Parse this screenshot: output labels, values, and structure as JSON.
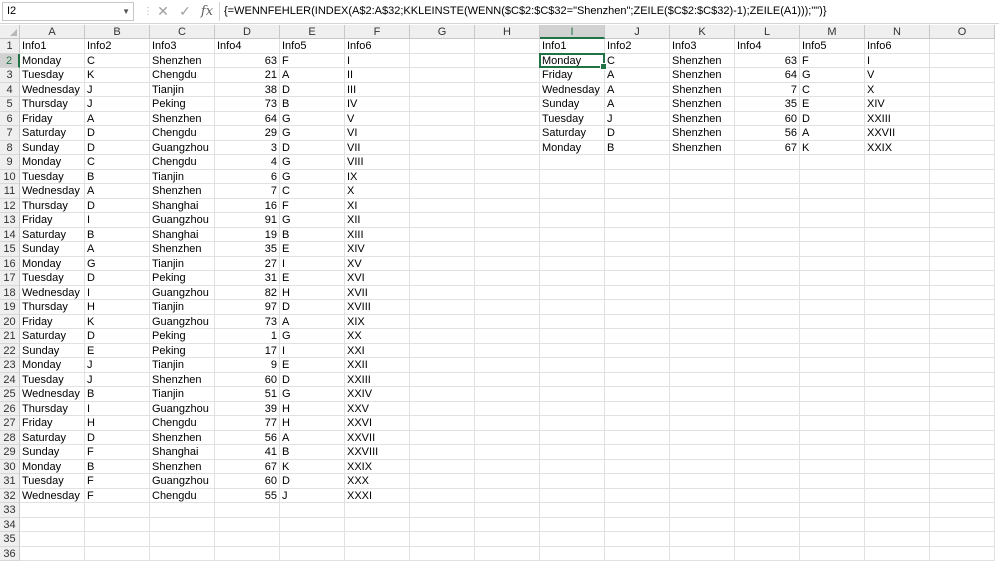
{
  "formula_bar": {
    "name_box": "I2",
    "formula": "{=WENNFEHLER(INDEX(A$2:A$32;KKLEINSTE(WENN($C$2:$C$32=\"Shenzhen\";ZEILE($C$2:$C$32)-1);ZEILE(A1)));\"\")}"
  },
  "columns": [
    "A",
    "B",
    "C",
    "D",
    "E",
    "F",
    "G",
    "H",
    "I",
    "J",
    "K",
    "L",
    "M",
    "N",
    "O"
  ],
  "row_numbers": [
    "1",
    "2",
    "3",
    "4",
    "5",
    "6",
    "7",
    "8",
    "9",
    "10",
    "11",
    "12",
    "13",
    "14",
    "15",
    "16",
    "17",
    "18",
    "19",
    "20",
    "21",
    "22",
    "23",
    "24",
    "25",
    "26",
    "27",
    "28",
    "29",
    "30",
    "31",
    "32",
    "33",
    "34",
    "35",
    "36"
  ],
  "left_headers": [
    "Info1",
    "Info2",
    "Info3",
    "Info4",
    "Info5",
    "Info6"
  ],
  "left_rows": [
    [
      "Monday",
      "C",
      "Shenzhen",
      "63",
      "F",
      "I"
    ],
    [
      "Tuesday",
      "K",
      "Chengdu",
      "21",
      "A",
      "II"
    ],
    [
      "Wednesday",
      "J",
      "Tianjin",
      "38",
      "D",
      "III"
    ],
    [
      "Thursday",
      "J",
      "Peking",
      "73",
      "B",
      "IV"
    ],
    [
      "Friday",
      "A",
      "Shenzhen",
      "64",
      "G",
      "V"
    ],
    [
      "Saturday",
      "D",
      "Chengdu",
      "29",
      "G",
      "VI"
    ],
    [
      "Sunday",
      "D",
      "Guangzhou",
      "3",
      "D",
      "VII"
    ],
    [
      "Monday",
      "C",
      "Chengdu",
      "4",
      "G",
      "VIII"
    ],
    [
      "Tuesday",
      "B",
      "Tianjin",
      "6",
      "G",
      "IX"
    ],
    [
      "Wednesday",
      "A",
      "Shenzhen",
      "7",
      "C",
      "X"
    ],
    [
      "Thursday",
      "D",
      "Shanghai",
      "16",
      "F",
      "XI"
    ],
    [
      "Friday",
      "I",
      "Guangzhou",
      "91",
      "G",
      "XII"
    ],
    [
      "Saturday",
      "B",
      "Shanghai",
      "19",
      "B",
      "XIII"
    ],
    [
      "Sunday",
      "A",
      "Shenzhen",
      "35",
      "E",
      "XIV"
    ],
    [
      "Monday",
      "G",
      "Tianjin",
      "27",
      "I",
      "XV"
    ],
    [
      "Tuesday",
      "D",
      "Peking",
      "31",
      "E",
      "XVI"
    ],
    [
      "Wednesday",
      "I",
      "Guangzhou",
      "82",
      "H",
      "XVII"
    ],
    [
      "Thursday",
      "H",
      "Tianjin",
      "97",
      "D",
      "XVIII"
    ],
    [
      "Friday",
      "K",
      "Guangzhou",
      "73",
      "A",
      "XIX"
    ],
    [
      "Saturday",
      "D",
      "Peking",
      "1",
      "G",
      "XX"
    ],
    [
      "Sunday",
      "E",
      "Peking",
      "17",
      "I",
      "XXI"
    ],
    [
      "Monday",
      "J",
      "Tianjin",
      "9",
      "E",
      "XXII"
    ],
    [
      "Tuesday",
      "J",
      "Shenzhen",
      "60",
      "D",
      "XXIII"
    ],
    [
      "Wednesday",
      "B",
      "Tianjin",
      "51",
      "G",
      "XXIV"
    ],
    [
      "Thursday",
      "I",
      "Guangzhou",
      "39",
      "H",
      "XXV"
    ],
    [
      "Friday",
      "H",
      "Chengdu",
      "77",
      "H",
      "XXVI"
    ],
    [
      "Saturday",
      "D",
      "Shenzhen",
      "56",
      "A",
      "XXVII"
    ],
    [
      "Sunday",
      "F",
      "Shanghai",
      "41",
      "B",
      "XXVIII"
    ],
    [
      "Monday",
      "B",
      "Shenzhen",
      "67",
      "K",
      "XXIX"
    ],
    [
      "Tuesday",
      "F",
      "Guangzhou",
      "60",
      "D",
      "XXX"
    ],
    [
      "Wednesday",
      "F",
      "Chengdu",
      "55",
      "J",
      "XXXI"
    ]
  ],
  "right_headers": [
    "Info1",
    "Info2",
    "Info3",
    "Info4",
    "Info5",
    "Info6"
  ],
  "right_rows": [
    [
      "Monday",
      "C",
      "Shenzhen",
      "63",
      "F",
      "I"
    ],
    [
      "Friday",
      "A",
      "Shenzhen",
      "64",
      "G",
      "V"
    ],
    [
      "Wednesday",
      "A",
      "Shenzhen",
      "7",
      "C",
      "X"
    ],
    [
      "Sunday",
      "A",
      "Shenzhen",
      "35",
      "E",
      "XIV"
    ],
    [
      "Tuesday",
      "J",
      "Shenzhen",
      "60",
      "D",
      "XXIII"
    ],
    [
      "Saturday",
      "D",
      "Shenzhen",
      "56",
      "A",
      "XXVII"
    ],
    [
      "Monday",
      "B",
      "Shenzhen",
      "67",
      "K",
      "XXIX"
    ]
  ],
  "selected_cell": "I2",
  "colors": {
    "accent": "#217346",
    "header_bg": "#efefef",
    "gridline": "#e1e1e1"
  }
}
